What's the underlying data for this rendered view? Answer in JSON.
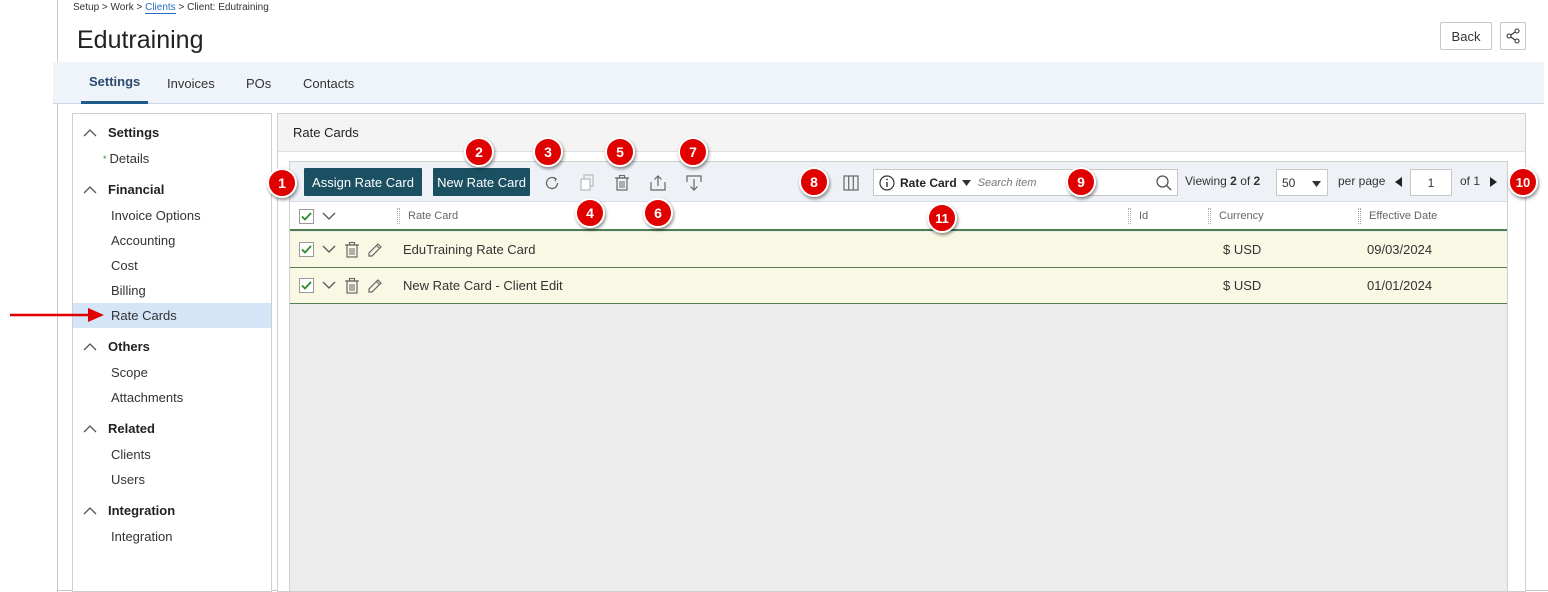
{
  "breadcrumb": {
    "setup": "Setup",
    "work": "Work",
    "clients": "Clients",
    "current": "Client: Edutraining",
    "sep": ">"
  },
  "page": {
    "title": "Edutraining"
  },
  "header": {
    "back_label": "Back",
    "share_icon": "share-icon"
  },
  "tabs": [
    {
      "label": "Settings",
      "active": true
    },
    {
      "label": "Invoices"
    },
    {
      "label": "POs"
    },
    {
      "label": "Contacts"
    }
  ],
  "sidebar": {
    "sections": [
      {
        "title": "Settings",
        "items": [
          "Details"
        ]
      },
      {
        "title": "Financial",
        "items": [
          "Invoice Options",
          "Accounting",
          "Cost",
          "Billing",
          "Rate Cards"
        ]
      },
      {
        "title": "Others",
        "items": [
          "Scope",
          "Attachments"
        ]
      },
      {
        "title": "Related",
        "items": [
          "Clients",
          "Users"
        ]
      },
      {
        "title": "Integration",
        "items": [
          "Integration"
        ]
      }
    ],
    "selected": "Rate Cards",
    "details_marker": "*"
  },
  "main": {
    "title": "Rate Cards",
    "toolbar": {
      "assign_label": "Assign Rate Card",
      "new_label": "New Rate Card",
      "search": {
        "scope": "Rate Card",
        "placeholder": "Search item"
      },
      "viewing_prefix": "Viewing",
      "viewing_count": "2",
      "viewing_of": "of",
      "viewing_total": "2",
      "per_page_value": "50",
      "per_page_label": "per page",
      "page_value": "1",
      "page_of": "of 1"
    },
    "columns": [
      "Rate Card",
      "Id",
      "Currency",
      "Effective Date"
    ],
    "rows": [
      {
        "rate_card": "EduTraining Rate Card",
        "id": "",
        "currency": "$ USD",
        "effective_date": "09/03/2024"
      },
      {
        "rate_card": "New Rate Card - Client Edit",
        "id": "",
        "currency": "$ USD",
        "effective_date": "01/01/2024"
      }
    ]
  },
  "callouts": [
    "1",
    "2",
    "3",
    "4",
    "5",
    "6",
    "7",
    "8",
    "9",
    "10",
    "11"
  ],
  "colors": {
    "primary_button": "#1b4f62",
    "callout": "#e00000",
    "selected_nav": "#d4e5f7",
    "row_bg": "#f8f8e5"
  }
}
